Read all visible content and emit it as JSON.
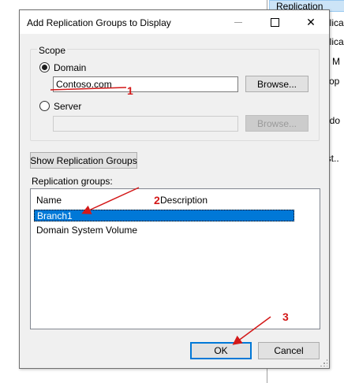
{
  "background_window": {
    "header": "Replication",
    "fragments": [
      "plica",
      "plica",
      "e M",
      "Top",
      "ndo",
      "ist.."
    ]
  },
  "dialog": {
    "title": "Add Replication Groups to Display",
    "close_glyph": "✕",
    "scope": {
      "label": "Scope",
      "domain_label": "Domain",
      "domain_value": "Contoso.com",
      "domain_browse": "Browse...",
      "server_label": "Server",
      "server_value": "",
      "server_browse": "Browse..."
    },
    "show_button": "Show Replication Groups",
    "list": {
      "label": "Replication groups:",
      "columns": [
        "Name",
        "Description"
      ],
      "rows": [
        "Branch1",
        "Domain System Volume"
      ]
    },
    "ok_button": "OK",
    "cancel_button": "Cancel"
  },
  "annotations": [
    "1",
    "2",
    "3"
  ],
  "colors": {
    "accent": "#0078d7",
    "annotation": "#d31818"
  }
}
